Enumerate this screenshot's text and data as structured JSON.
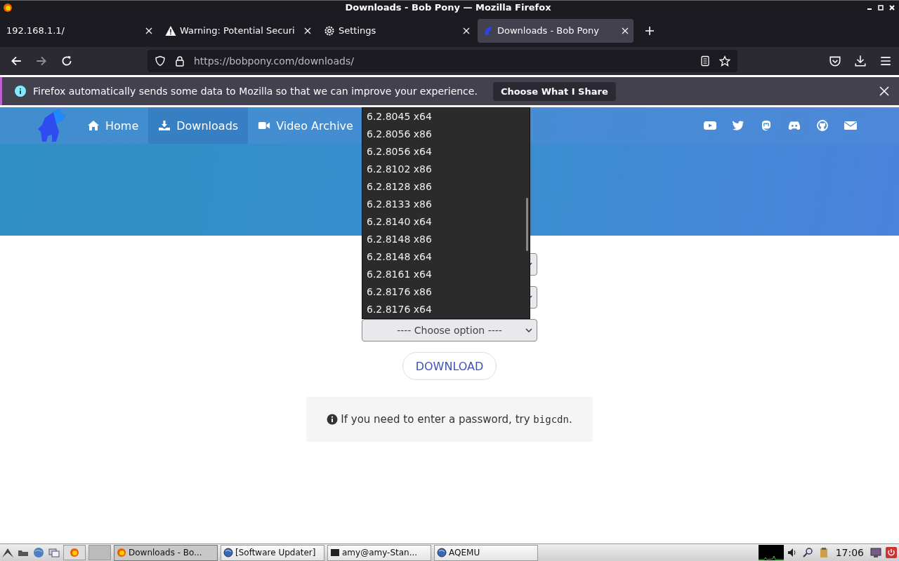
{
  "window": {
    "title": "Downloads - Bob Pony — Mozilla Firefox"
  },
  "tabs": [
    {
      "label": "192.168.1.1/",
      "kind": "plain",
      "selected": false
    },
    {
      "label": "Warning: Potential Securi",
      "kind": "warning",
      "selected": false
    },
    {
      "label": "Settings",
      "kind": "settings",
      "selected": false
    },
    {
      "label": "Downloads - Bob Pony",
      "kind": "site",
      "selected": true
    }
  ],
  "address_bar": {
    "url": "https://bobpony.com/downloads/"
  },
  "notification": {
    "message": "Firefox automatically sends some data to Mozilla so that we can improve your experience.",
    "button": "Choose What I Share"
  },
  "site_nav": {
    "items": [
      {
        "label": "Home",
        "selected": false
      },
      {
        "label": "Downloads",
        "selected": true
      },
      {
        "label": "Video Archive",
        "selected": false
      }
    ]
  },
  "form": {
    "selects": [
      {
        "kind": "covered"
      },
      {
        "kind": "covered"
      },
      {
        "kind": "shown",
        "value": "---- Choose option ----"
      }
    ],
    "dropdown": {
      "options": [
        "6.2.8045 x64",
        "6.2.8056 x86",
        "6.2.8056 x64",
        "6.2.8102 x86",
        "6.2.8128 x86",
        "6.2.8133 x86",
        "6.2.8140 x64",
        "6.2.8148 x86",
        "6.2.8148 x64",
        "6.2.8161 x64",
        "6.2.8176 x86",
        "6.2.8176 x64"
      ]
    },
    "download_button": "DOWNLOAD",
    "note": {
      "text": "If you need to enter a password, try",
      "code": "bigcdn",
      "end": "."
    }
  },
  "taskbar": {
    "windows": [
      {
        "label": "Downloads - Bo...",
        "kind": "firefox",
        "selected": true
      },
      {
        "label": "[Software Updater]",
        "kind": "globe",
        "selected": false
      },
      {
        "label": "amy@amy-Stan...",
        "kind": "terminal",
        "selected": false
      },
      {
        "label": "AQEMU",
        "kind": "globe",
        "selected": false
      }
    ],
    "clock": "17:06"
  }
}
